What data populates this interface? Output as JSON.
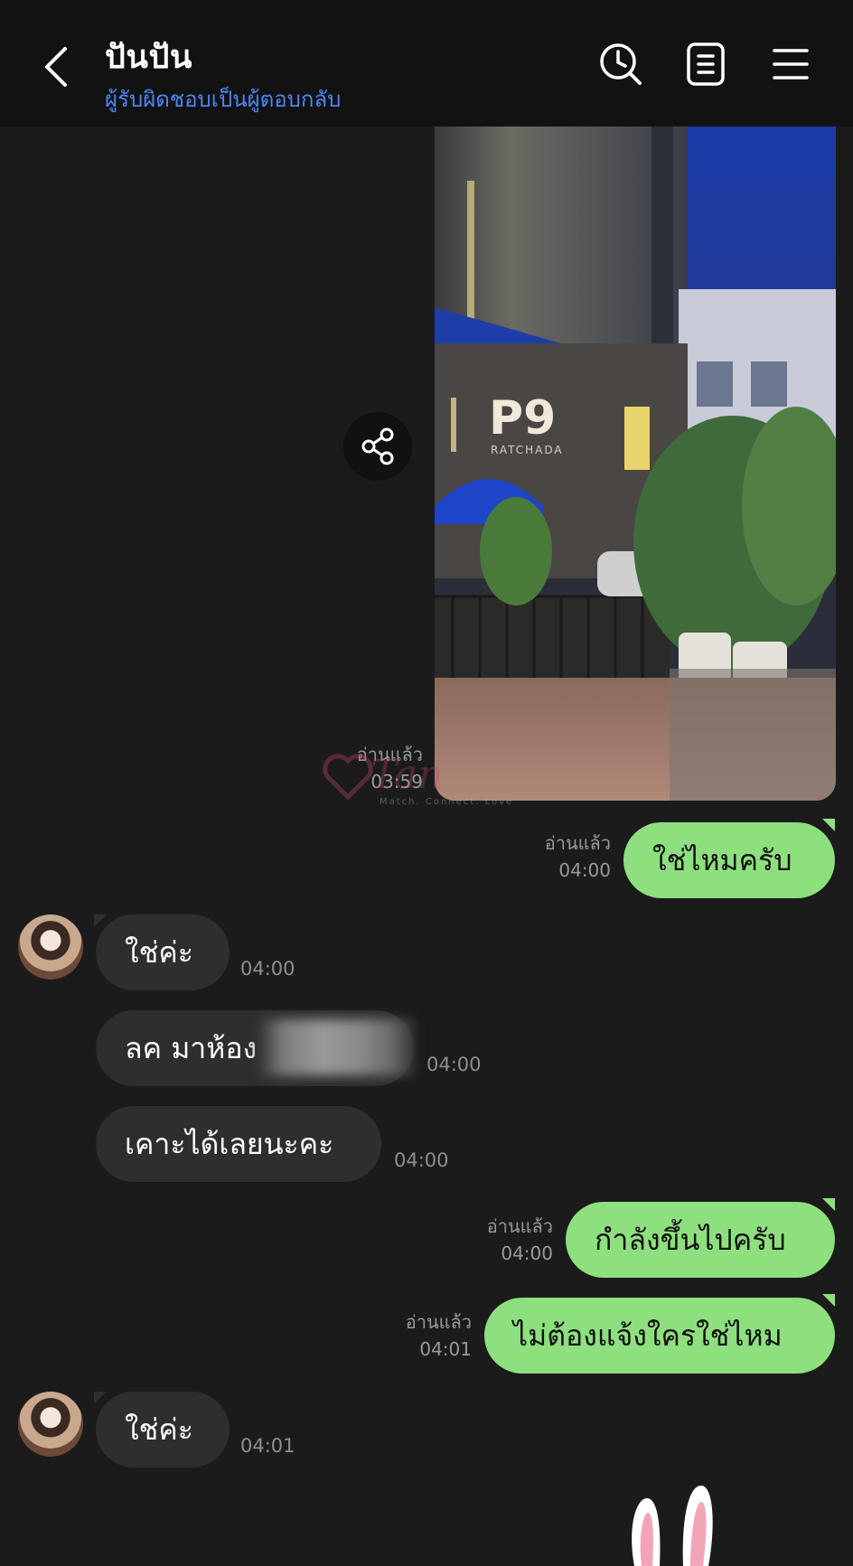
{
  "header": {
    "title": "ปันปัน",
    "subtitle": "ผู้รับผิดชอบเป็นผู้ตอบกลับ",
    "icons": [
      "back-icon",
      "clock-search-icon",
      "notes-icon",
      "menu-icon"
    ]
  },
  "photo_message": {
    "sign_text": "P9",
    "sign_sub": "RATCHADA",
    "read_label": "อ่านแล้ว",
    "time": "03:59",
    "watermark": "Tan",
    "watermark_tag": "Match. Connect. Love"
  },
  "messages": [
    {
      "id": "m1",
      "dir": "out",
      "text": "ใช่ไหมครับ",
      "read": "อ่านแล้ว",
      "time": "04:00"
    },
    {
      "id": "m2",
      "dir": "in",
      "text": "ใช่ค่ะ",
      "time": "04:00"
    },
    {
      "id": "m3",
      "dir": "in",
      "text": "ลค มาห้อง",
      "time": "04:00"
    },
    {
      "id": "m4",
      "dir": "in",
      "text": "เคาะได้เลยนะคะ",
      "time": "04:00"
    },
    {
      "id": "m5",
      "dir": "out",
      "text": "กำลังขึ้นไปครับ",
      "read": "อ่านแล้ว",
      "time": "04:00"
    },
    {
      "id": "m6",
      "dir": "out",
      "text": "ไม่ต้องแจ้งใครใช่ไหม",
      "read": "อ่านแล้ว",
      "time": "04:01"
    },
    {
      "id": "m7",
      "dir": "in",
      "text": "ใช่ค่ะ",
      "time": "04:01"
    }
  ],
  "colors": {
    "background": "#1b1b1b",
    "header_bg": "#121212",
    "outgoing_bubble": "#8ee07f",
    "incoming_bubble": "#2e2e2e",
    "subtitle": "#4c86f5"
  }
}
